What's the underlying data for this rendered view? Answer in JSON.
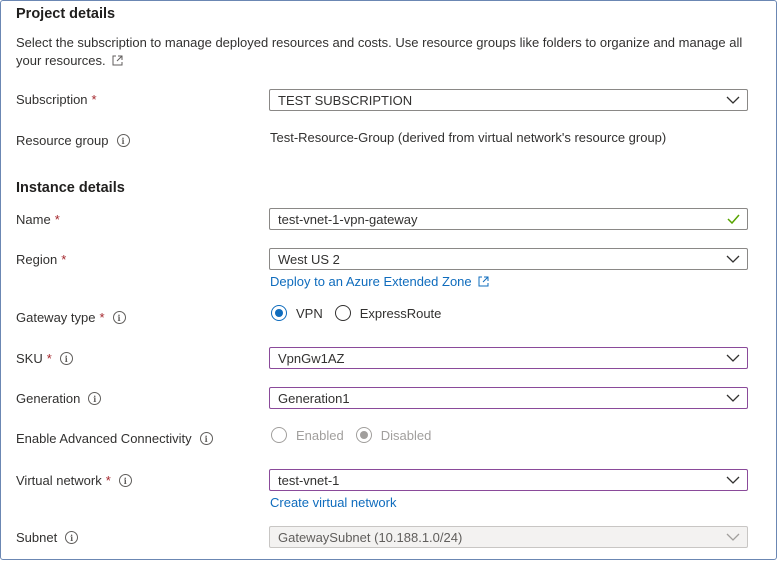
{
  "project": {
    "title": "Project details",
    "description": "Select the subscription to manage deployed resources and costs. Use resource groups like folders to organize and manage all your resources."
  },
  "subscription": {
    "label": "Subscription",
    "required_mark": "*",
    "value": "TEST SUBSCRIPTION"
  },
  "resource_group": {
    "label": "Resource group",
    "value": "Test-Resource-Group (derived from virtual network's resource group)"
  },
  "instance": {
    "title": "Instance details"
  },
  "name": {
    "label": "Name",
    "required_mark": "*",
    "value": "test-vnet-1-vpn-gateway"
  },
  "region": {
    "label": "Region",
    "required_mark": "*",
    "value": "West US 2",
    "link": "Deploy to an Azure Extended Zone"
  },
  "gateway_type": {
    "label": "Gateway type",
    "required_mark": "*",
    "options": [
      "VPN",
      "ExpressRoute"
    ],
    "selected": "VPN"
  },
  "sku": {
    "label": "SKU",
    "required_mark": "*",
    "value": "VpnGw1AZ"
  },
  "generation": {
    "label": "Generation",
    "value": "Generation1"
  },
  "advanced": {
    "label": "Enable Advanced Connectivity",
    "options": [
      "Enabled",
      "Disabled"
    ],
    "selected": "Disabled"
  },
  "vnet": {
    "label": "Virtual network",
    "required_mark": "*",
    "value": "test-vnet-1",
    "link": "Create virtual network"
  },
  "subnet": {
    "label": "Subnet",
    "value": "GatewaySubnet (10.188.1.0/24)"
  },
  "colors": {
    "accent": "#0f6cbd",
    "required": "#a4262c",
    "valid": "#57a300",
    "focus_border": "#8a4a9a"
  }
}
